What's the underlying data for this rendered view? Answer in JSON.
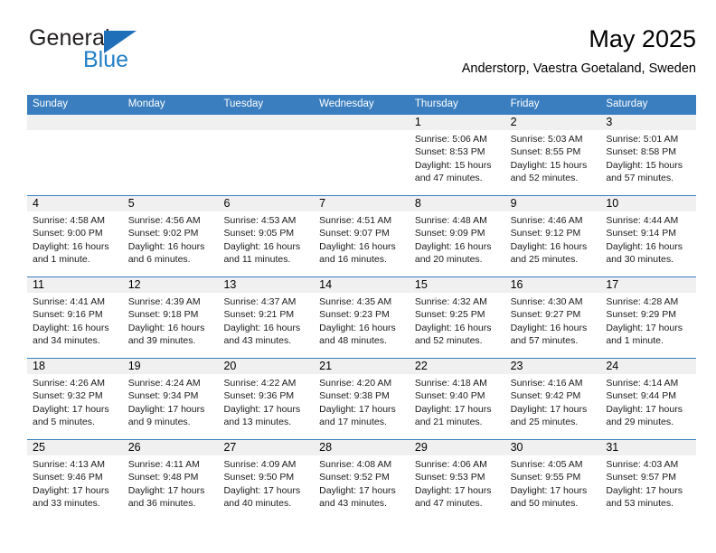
{
  "brand": {
    "name_part1": "General",
    "name_part2": "Blue",
    "triangle_color": "#1f6fb8",
    "blue_text_color": "#2380c6"
  },
  "header": {
    "title": "May 2025",
    "subtitle": "Anderstorp, Vaestra Goetaland, Sweden",
    "header_bg_color": "#3a7ebf",
    "datenum_bg_color": "#f0f0f0"
  },
  "weekdays": [
    "Sunday",
    "Monday",
    "Tuesday",
    "Wednesday",
    "Thursday",
    "Friday",
    "Saturday"
  ],
  "weeks": [
    [
      {
        "day": "",
        "empty": true
      },
      {
        "day": "",
        "empty": true
      },
      {
        "day": "",
        "empty": true
      },
      {
        "day": "",
        "empty": true
      },
      {
        "day": "1",
        "sunrise": "Sunrise: 5:06 AM",
        "sunset": "Sunset: 8:53 PM",
        "daylight": "Daylight: 15 hours and 47 minutes."
      },
      {
        "day": "2",
        "sunrise": "Sunrise: 5:03 AM",
        "sunset": "Sunset: 8:55 PM",
        "daylight": "Daylight: 15 hours and 52 minutes."
      },
      {
        "day": "3",
        "sunrise": "Sunrise: 5:01 AM",
        "sunset": "Sunset: 8:58 PM",
        "daylight": "Daylight: 15 hours and 57 minutes."
      }
    ],
    [
      {
        "day": "4",
        "sunrise": "Sunrise: 4:58 AM",
        "sunset": "Sunset: 9:00 PM",
        "daylight": "Daylight: 16 hours and 1 minute."
      },
      {
        "day": "5",
        "sunrise": "Sunrise: 4:56 AM",
        "sunset": "Sunset: 9:02 PM",
        "daylight": "Daylight: 16 hours and 6 minutes."
      },
      {
        "day": "6",
        "sunrise": "Sunrise: 4:53 AM",
        "sunset": "Sunset: 9:05 PM",
        "daylight": "Daylight: 16 hours and 11 minutes."
      },
      {
        "day": "7",
        "sunrise": "Sunrise: 4:51 AM",
        "sunset": "Sunset: 9:07 PM",
        "daylight": "Daylight: 16 hours and 16 minutes."
      },
      {
        "day": "8",
        "sunrise": "Sunrise: 4:48 AM",
        "sunset": "Sunset: 9:09 PM",
        "daylight": "Daylight: 16 hours and 20 minutes."
      },
      {
        "day": "9",
        "sunrise": "Sunrise: 4:46 AM",
        "sunset": "Sunset: 9:12 PM",
        "daylight": "Daylight: 16 hours and 25 minutes."
      },
      {
        "day": "10",
        "sunrise": "Sunrise: 4:44 AM",
        "sunset": "Sunset: 9:14 PM",
        "daylight": "Daylight: 16 hours and 30 minutes."
      }
    ],
    [
      {
        "day": "11",
        "sunrise": "Sunrise: 4:41 AM",
        "sunset": "Sunset: 9:16 PM",
        "daylight": "Daylight: 16 hours and 34 minutes."
      },
      {
        "day": "12",
        "sunrise": "Sunrise: 4:39 AM",
        "sunset": "Sunset: 9:18 PM",
        "daylight": "Daylight: 16 hours and 39 minutes."
      },
      {
        "day": "13",
        "sunrise": "Sunrise: 4:37 AM",
        "sunset": "Sunset: 9:21 PM",
        "daylight": "Daylight: 16 hours and 43 minutes."
      },
      {
        "day": "14",
        "sunrise": "Sunrise: 4:35 AM",
        "sunset": "Sunset: 9:23 PM",
        "daylight": "Daylight: 16 hours and 48 minutes."
      },
      {
        "day": "15",
        "sunrise": "Sunrise: 4:32 AM",
        "sunset": "Sunset: 9:25 PM",
        "daylight": "Daylight: 16 hours and 52 minutes."
      },
      {
        "day": "16",
        "sunrise": "Sunrise: 4:30 AM",
        "sunset": "Sunset: 9:27 PM",
        "daylight": "Daylight: 16 hours and 57 minutes."
      },
      {
        "day": "17",
        "sunrise": "Sunrise: 4:28 AM",
        "sunset": "Sunset: 9:29 PM",
        "daylight": "Daylight: 17 hours and 1 minute."
      }
    ],
    [
      {
        "day": "18",
        "sunrise": "Sunrise: 4:26 AM",
        "sunset": "Sunset: 9:32 PM",
        "daylight": "Daylight: 17 hours and 5 minutes."
      },
      {
        "day": "19",
        "sunrise": "Sunrise: 4:24 AM",
        "sunset": "Sunset: 9:34 PM",
        "daylight": "Daylight: 17 hours and 9 minutes."
      },
      {
        "day": "20",
        "sunrise": "Sunrise: 4:22 AM",
        "sunset": "Sunset: 9:36 PM",
        "daylight": "Daylight: 17 hours and 13 minutes."
      },
      {
        "day": "21",
        "sunrise": "Sunrise: 4:20 AM",
        "sunset": "Sunset: 9:38 PM",
        "daylight": "Daylight: 17 hours and 17 minutes."
      },
      {
        "day": "22",
        "sunrise": "Sunrise: 4:18 AM",
        "sunset": "Sunset: 9:40 PM",
        "daylight": "Daylight: 17 hours and 21 minutes."
      },
      {
        "day": "23",
        "sunrise": "Sunrise: 4:16 AM",
        "sunset": "Sunset: 9:42 PM",
        "daylight": "Daylight: 17 hours and 25 minutes."
      },
      {
        "day": "24",
        "sunrise": "Sunrise: 4:14 AM",
        "sunset": "Sunset: 9:44 PM",
        "daylight": "Daylight: 17 hours and 29 minutes."
      }
    ],
    [
      {
        "day": "25",
        "sunrise": "Sunrise: 4:13 AM",
        "sunset": "Sunset: 9:46 PM",
        "daylight": "Daylight: 17 hours and 33 minutes."
      },
      {
        "day": "26",
        "sunrise": "Sunrise: 4:11 AM",
        "sunset": "Sunset: 9:48 PM",
        "daylight": "Daylight: 17 hours and 36 minutes."
      },
      {
        "day": "27",
        "sunrise": "Sunrise: 4:09 AM",
        "sunset": "Sunset: 9:50 PM",
        "daylight": "Daylight: 17 hours and 40 minutes."
      },
      {
        "day": "28",
        "sunrise": "Sunrise: 4:08 AM",
        "sunset": "Sunset: 9:52 PM",
        "daylight": "Daylight: 17 hours and 43 minutes."
      },
      {
        "day": "29",
        "sunrise": "Sunrise: 4:06 AM",
        "sunset": "Sunset: 9:53 PM",
        "daylight": "Daylight: 17 hours and 47 minutes."
      },
      {
        "day": "30",
        "sunrise": "Sunrise: 4:05 AM",
        "sunset": "Sunset: 9:55 PM",
        "daylight": "Daylight: 17 hours and 50 minutes."
      },
      {
        "day": "31",
        "sunrise": "Sunrise: 4:03 AM",
        "sunset": "Sunset: 9:57 PM",
        "daylight": "Daylight: 17 hours and 53 minutes."
      }
    ]
  ]
}
